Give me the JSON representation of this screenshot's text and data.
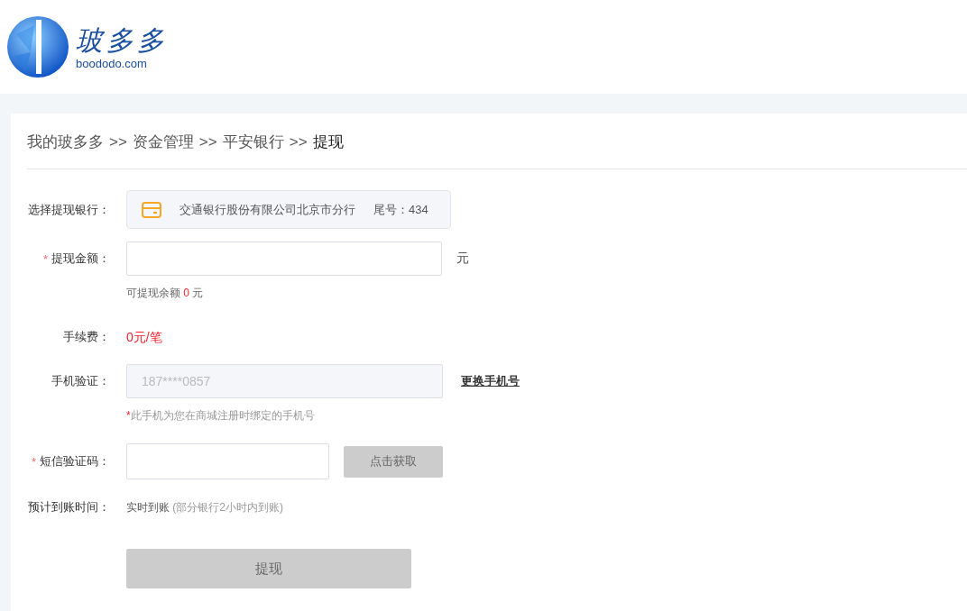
{
  "logo": {
    "name": "玻多多",
    "domain": "boododo.com"
  },
  "breadcrumb": [
    {
      "label": "我的玻多多",
      "kind": "link"
    },
    {
      "label": ">>",
      "kind": "separator"
    },
    {
      "label": "资金管理",
      "kind": "link"
    },
    {
      "label": ">>",
      "kind": "separator"
    },
    {
      "label": "平安银行",
      "kind": "link"
    },
    {
      "label": ">>",
      "kind": "separator"
    },
    {
      "label": "提现",
      "kind": "current"
    }
  ],
  "bank": {
    "label": "选择提现银行：",
    "bank_name": "交通银行股份有限公司北京市分行",
    "tail": "尾号：434"
  },
  "amount": {
    "required_mark": "*",
    "label": "提现金额：",
    "unit": "元",
    "balance_prefix": "可提现余额",
    "balance": "0",
    "balance_unit": "元"
  },
  "fee": {
    "label": "手续费：",
    "value": "0元/笔"
  },
  "phone": {
    "label": "手机验证：",
    "placeholder": "187****0857",
    "link": "更换手机号",
    "note_mark": "*",
    "note": "此手机为您在商城注册时绑定的手机号"
  },
  "sms": {
    "required_mark": "*",
    "label": "短信验证码：",
    "button": "点击获取"
  },
  "arrival": {
    "label": "预计到账时间：",
    "value": "实时到账",
    "note": "(部分银行2小时内到账)"
  },
  "submit": {
    "label": "提现",
    "disabled": true
  }
}
